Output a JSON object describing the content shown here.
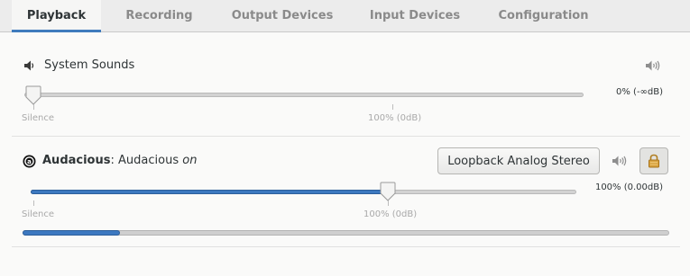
{
  "tabs": [
    {
      "label": "Playback",
      "active": true
    },
    {
      "label": "Recording",
      "active": false
    },
    {
      "label": "Output Devices",
      "active": false
    },
    {
      "label": "Input Devices",
      "active": false
    },
    {
      "label": "Configuration",
      "active": false
    }
  ],
  "system_sounds": {
    "title": "System Sounds",
    "icon": "speaker-icon",
    "volume_percent": 0,
    "value_text": "0% (-∞dB)",
    "mark_silence": "Silence",
    "mark_100": "100% (0dB)"
  },
  "audacious": {
    "app_name": "Audacious",
    "separator": ":",
    "stream_name": "Audacious",
    "status": "on",
    "icon": "audacious-icon",
    "device_button": "Loopback Analog Stereo",
    "volume_percent": 100,
    "value_text": "100% (0.00dB)",
    "mark_silence": "Silence",
    "mark_100": "100% (0dB)",
    "peak_level": 0.15,
    "lock_icon": "lock-icon"
  },
  "colors": {
    "accent": "#3c78c0",
    "lock": "#d9a441"
  }
}
